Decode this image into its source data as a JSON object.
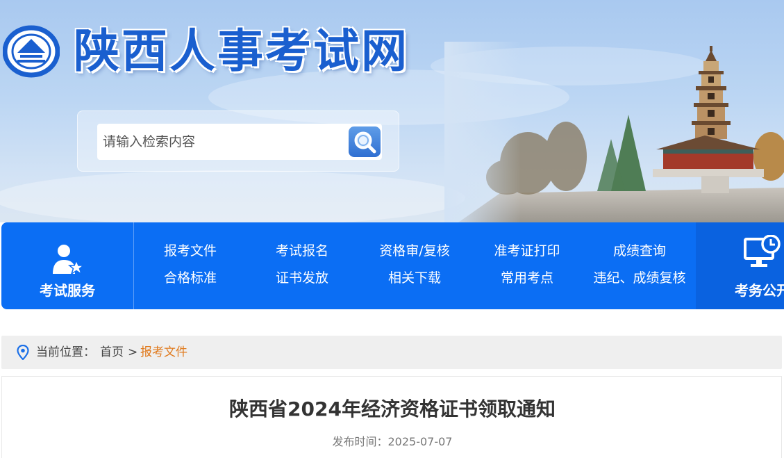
{
  "header": {
    "site_title": "陕西人事考试网",
    "search": {
      "placeholder": "请输入检索内容",
      "value": ""
    }
  },
  "nav": {
    "service_label": "考试服务",
    "right_label": "考务公开",
    "links": [
      "报考文件",
      "考试报名",
      "资格审/复核",
      "准考证打印",
      "成绩查询",
      "合格标准",
      "证书发放",
      "相关下载",
      "常用考点",
      "违纪、成绩复核"
    ]
  },
  "breadcrumb": {
    "label": "当前位置：",
    "home": "首页",
    "separator": ">",
    "current": "报考文件"
  },
  "article": {
    "title": "陕西省2024年经济资格证书领取通知",
    "date": "发布时间：2025-07-07"
  },
  "colors": {
    "nav_blue": "#0b6ef4",
    "title_blue": "#1a5fcf",
    "crumb_orange": "#e07a1d"
  },
  "icons": {
    "logo": "pagoda-emblem-icon",
    "search": "search-icon",
    "service": "person-star-icon",
    "public": "monitor-clock-icon",
    "pin": "location-pin-icon"
  }
}
